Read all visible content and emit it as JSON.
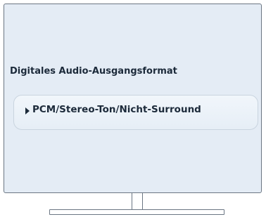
{
  "screen": {
    "setting_label": "Digitales Audio-Ausgangsformat",
    "selected_option": "PCM/Stereo-Ton/Nicht-Surround",
    "arrow_icon": "triangle-right-icon"
  },
  "colors": {
    "screen_background": "#e4ecf5",
    "frame": "#6b7683",
    "text": "#1c2a3a",
    "option_border": "#c9d4df"
  }
}
